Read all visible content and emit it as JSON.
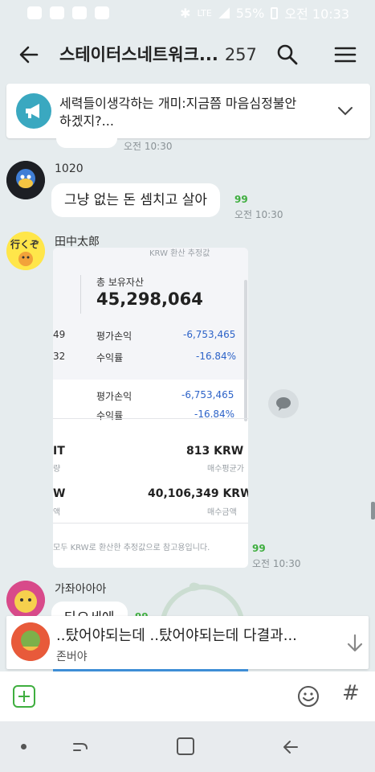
{
  "status_bar": {
    "network": "LTE",
    "battery": "55%",
    "time": "오전 10:33"
  },
  "header": {
    "title": "스테이터스네트워크...",
    "member_count": "257",
    "icons": [
      "back-arrow-icon",
      "search-icon",
      "hamburger-menu-icon"
    ]
  },
  "notice": {
    "text": "세력들이생각하는 개미:지금쯤 마음심정불안하겠지?...",
    "icon": "megaphone-icon"
  },
  "messages": [
    {
      "time": "오전 10:30"
    },
    {
      "sender": "1020",
      "text": "그냥 없는 돈 셈치고 살아",
      "unread": "99",
      "time": "오전 10:30"
    },
    {
      "sender": "田中太郎",
      "unread": "99",
      "time": "오전 10:30",
      "image": {
        "header_label": "KRW 환산 추정값",
        "total_label": "총 보유자산",
        "total_value": "45,298,064",
        "rows_top": [
          {
            "label": "평가손익",
            "value": "-6,753,465",
            "left": "49"
          },
          {
            "label": "수익률",
            "value": "-16.84%",
            "left": "32"
          }
        ],
        "rows_mid": [
          {
            "label": "평가손익",
            "value": "-6,753,465"
          },
          {
            "label": "수익률",
            "value": "-16.84%"
          }
        ],
        "avg_value": "813 KRW",
        "avg_label": "매수평균가",
        "avg_left_main": "IT",
        "avg_left_sub": "량",
        "buy_value": "40,106,349 KRW",
        "buy_label": "매수금액",
        "buy_left_main": "W",
        "buy_left_sub": "액",
        "footnote": "모두 KRW로 환산한 추정값으로 참고용입니다."
      }
    },
    {
      "sender": "가좌아아아",
      "text": "타오세에",
      "unread": "99"
    }
  ],
  "new_message_preview": {
    "text": "..탔어야되는데 ..탔어야되는데 다결과...",
    "sender": "존버야",
    "icon": "arrow-down-icon"
  },
  "progress": {
    "fraction": 1.0
  },
  "input_bar": {
    "plus_icon": "plus-icon",
    "emoji_icon": "emoji-icon",
    "hash": "#"
  },
  "colors": {
    "background": "#e6ecee",
    "accent_green": "#3fae3f",
    "negative_blue": "#2d63c8",
    "notice_icon": "#3aa8c0"
  }
}
